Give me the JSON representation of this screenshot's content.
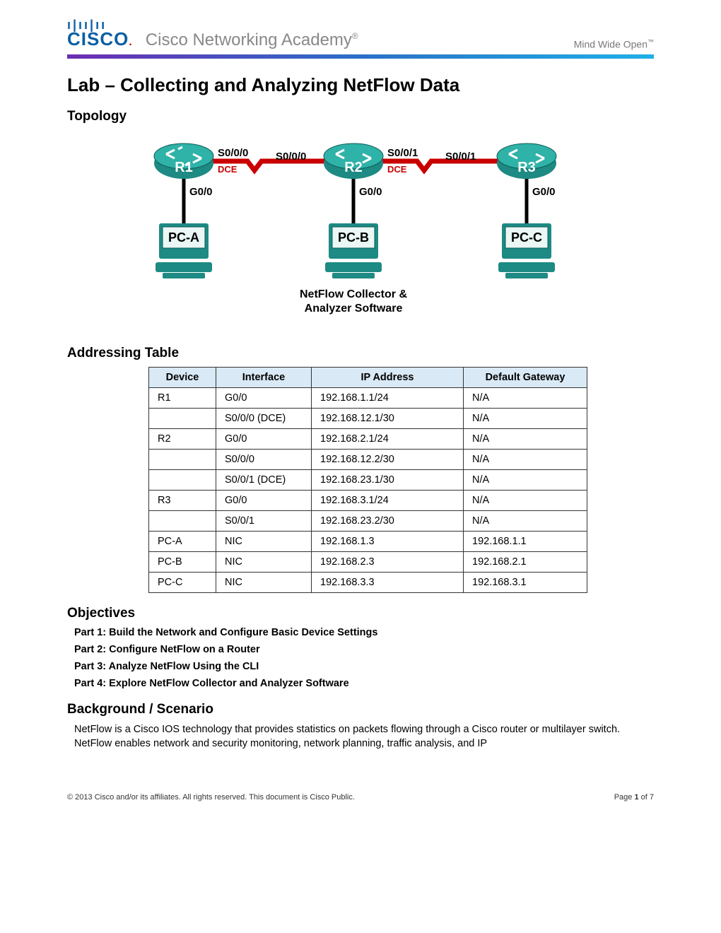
{
  "header": {
    "brand": "CISCO",
    "academy": "Cisco Networking Academy",
    "tagline": "Mind Wide Open"
  },
  "title": "Lab – Collecting and Analyzing NetFlow Data",
  "sections": {
    "topology": "Topology",
    "addressing": "Addressing Table",
    "objectives": "Objectives",
    "background": "Background / Scenario"
  },
  "topology": {
    "routers": [
      "R1",
      "R2",
      "R3"
    ],
    "pcs": [
      "PC-A",
      "PC-B",
      "PC-C"
    ],
    "ifG": "G0/0",
    "s000": "S0/0/0",
    "s001": "S0/0/1",
    "dce": "DCE",
    "caption1": "NetFlow Collector &",
    "caption2": "Analyzer Software"
  },
  "table": {
    "headers": [
      "Device",
      "Interface",
      "IP Address",
      "Default Gateway"
    ],
    "rows": [
      [
        "R1",
        "G0/0",
        "192.168.1.1/24",
        "N/A"
      ],
      [
        "",
        "S0/0/0 (DCE)",
        "192.168.12.1/30",
        "N/A"
      ],
      [
        "R2",
        "G0/0",
        "192.168.2.1/24",
        "N/A"
      ],
      [
        "",
        "S0/0/0",
        "192.168.12.2/30",
        "N/A"
      ],
      [
        "",
        "S0/0/1 (DCE)",
        "192.168.23.1/30",
        "N/A"
      ],
      [
        "R3",
        "G0/0",
        "192.168.3.1/24",
        "N/A"
      ],
      [
        "",
        "S0/0/1",
        "192.168.23.2/30",
        "N/A"
      ],
      [
        "PC-A",
        "NIC",
        "192.168.1.3",
        "192.168.1.1"
      ],
      [
        "PC-B",
        "NIC",
        "192.168.2.3",
        "192.168.2.1"
      ],
      [
        "PC-C",
        "NIC",
        "192.168.3.3",
        "192.168.3.1"
      ]
    ]
  },
  "objectives": [
    "Part 1: Build the Network and Configure Basic Device Settings",
    "Part 2: Configure NetFlow on a Router",
    "Part 3: Analyze NetFlow Using the CLI",
    "Part 4: Explore NetFlow Collector and Analyzer Software"
  ],
  "background": "NetFlow is a Cisco IOS technology that provides statistics on packets flowing through a Cisco router or multilayer switch. NetFlow enables network and security monitoring, network planning, traffic analysis, and IP",
  "footer": {
    "copyright": "© 2013 Cisco and/or its affiliates. All rights reserved. This document is Cisco Public.",
    "page": "Page 1 of 7"
  }
}
